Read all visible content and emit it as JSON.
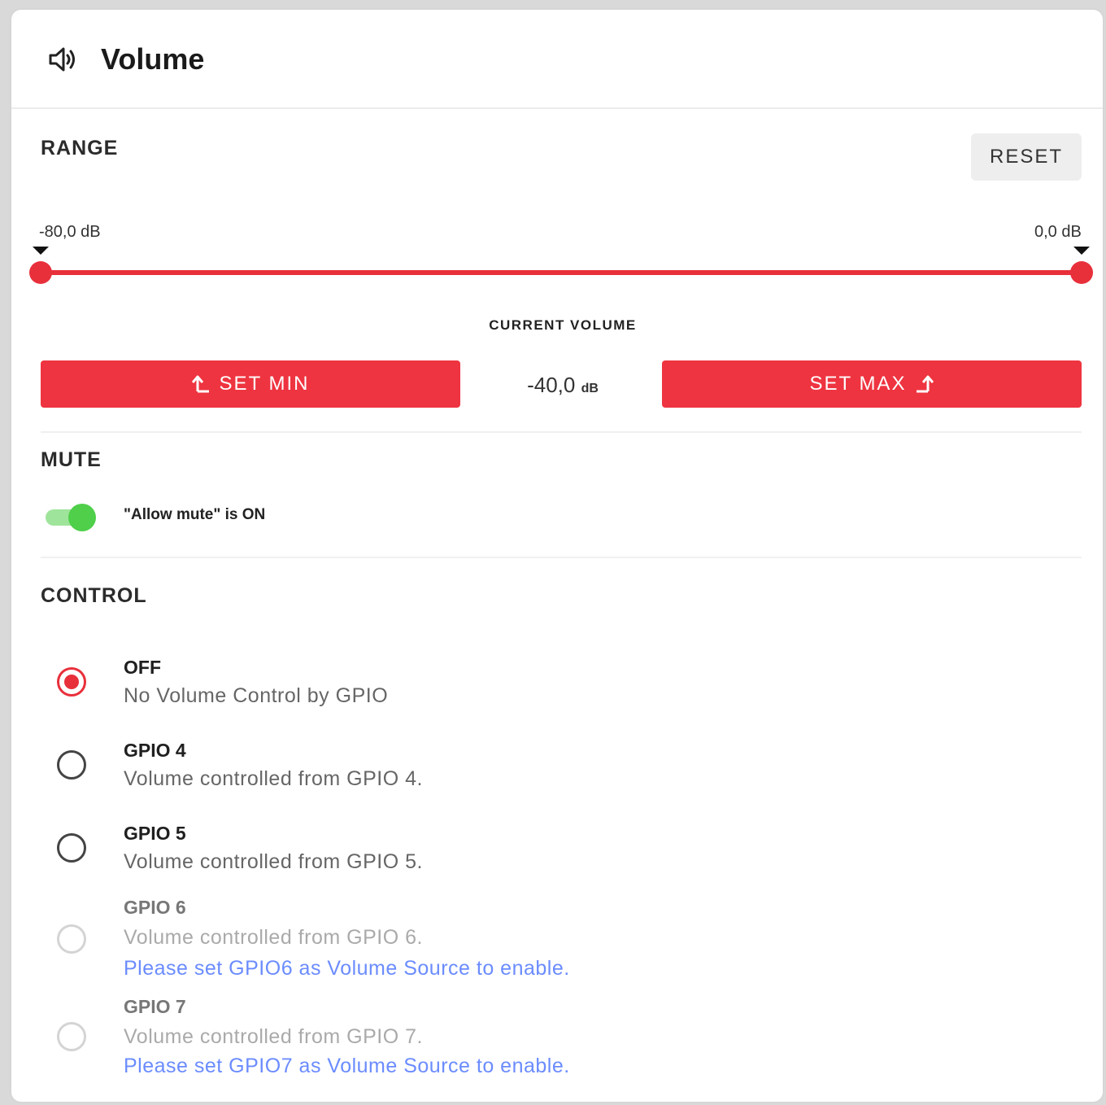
{
  "header": {
    "title": "Volume",
    "icon": "speaker-icon"
  },
  "range": {
    "section_title": "RANGE",
    "reset_label": "RESET",
    "min_label": "-80,0 dB",
    "max_label": "0,0 dB",
    "min_fraction": 0.0,
    "max_fraction": 1.0,
    "accent_color": "#e8303b"
  },
  "current_volume": {
    "label": "CURRENT VOLUME",
    "value": "-40,0",
    "unit": "dB",
    "set_min_label": "SET MIN",
    "set_max_label": "SET MAX"
  },
  "mute": {
    "section_title": "MUTE",
    "toggle_on": true,
    "toggle_label": "\"Allow mute\" is ON"
  },
  "control": {
    "section_title": "CONTROL",
    "selected": "OFF",
    "options": [
      {
        "title": "OFF",
        "description": "No Volume Control by GPIO",
        "checked": true,
        "disabled": false,
        "hint": ""
      },
      {
        "title": "GPIO 4",
        "description": "Volume controlled from GPIO 4.",
        "checked": false,
        "disabled": false,
        "hint": ""
      },
      {
        "title": "GPIO 5",
        "description": "Volume controlled from GPIO 5.",
        "checked": false,
        "disabled": false,
        "hint": ""
      },
      {
        "title": "GPIO 6",
        "description": "Volume controlled from GPIO 6.",
        "checked": false,
        "disabled": true,
        "hint": "Please set GPIO6 as Volume Source to enable."
      },
      {
        "title": "GPIO 7",
        "description": "Volume controlled from GPIO 7.",
        "checked": false,
        "disabled": true,
        "hint": "Please set GPIO7 as Volume Source to enable."
      }
    ]
  }
}
